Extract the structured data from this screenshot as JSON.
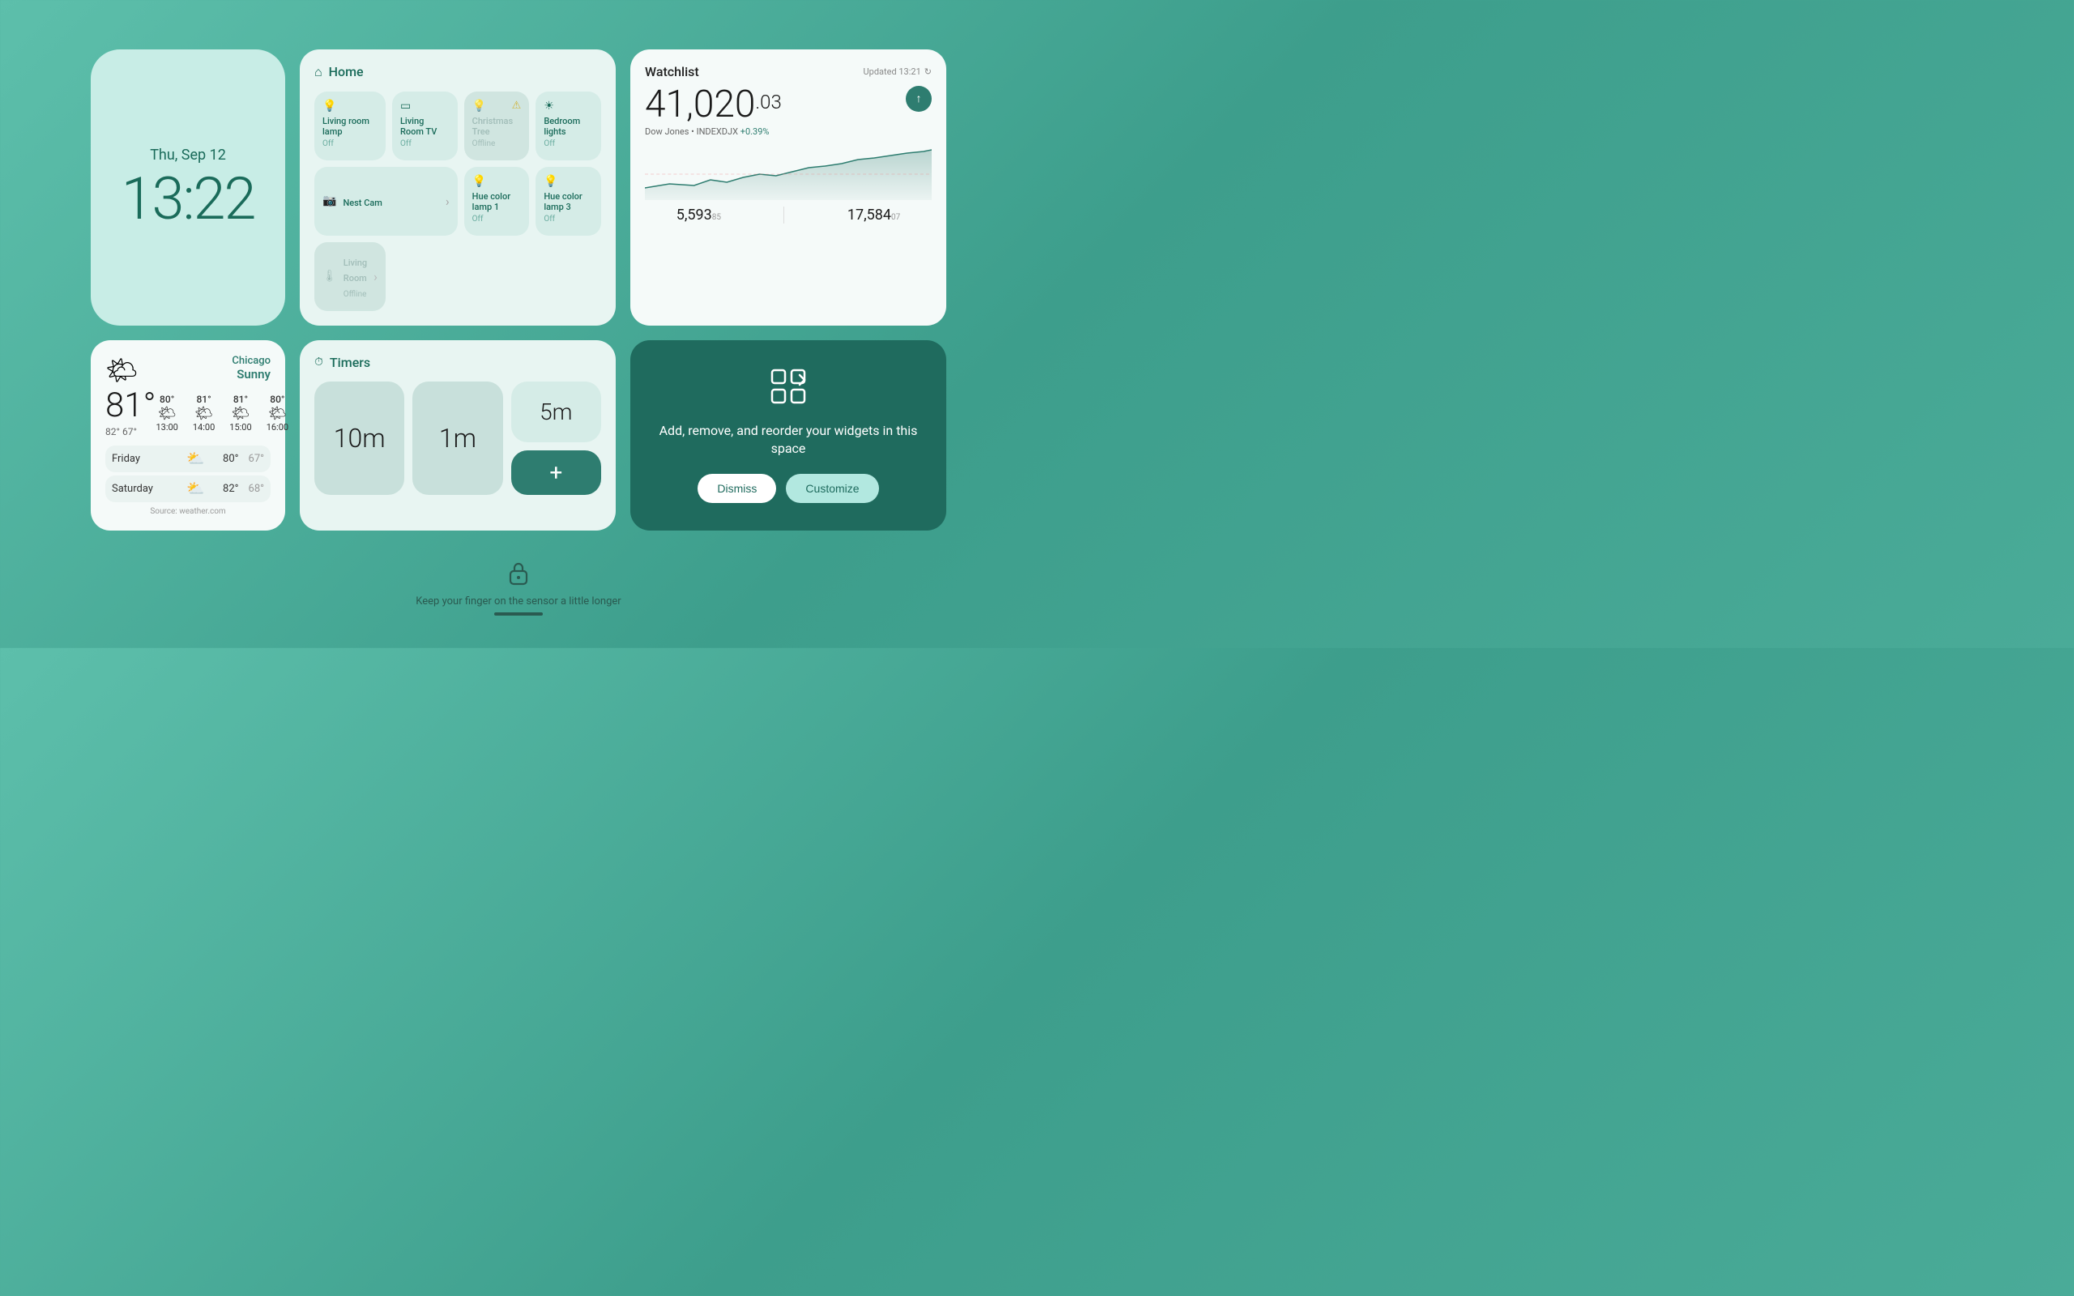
{
  "clock": {
    "date": "Thu, Sep 12",
    "time": "13:22"
  },
  "home": {
    "title": "Home",
    "devices": [
      {
        "name": "Living room lamp",
        "status": "Off",
        "offline": false,
        "icon": "💡"
      },
      {
        "name": "Living Room TV",
        "status": "Off",
        "offline": false,
        "icon": "📺"
      },
      {
        "name": "Christmas Tree",
        "status": "Offline",
        "offline": true,
        "icon": "💡",
        "warn": true
      },
      {
        "name": "Bedroom lights",
        "status": "Off",
        "offline": false,
        "icon": "🔆"
      },
      {
        "name": "Nest Cam",
        "status": "",
        "offline": false,
        "icon": "📷",
        "expand": true
      },
      {
        "name": "Hue color lamp 1",
        "status": "Off",
        "offline": false,
        "icon": "💡"
      },
      {
        "name": "Hue color lamp 3",
        "status": "Off",
        "offline": false,
        "icon": "💡"
      },
      {
        "name": "Living Room",
        "status": "Offline",
        "offline": true,
        "icon": "🌡",
        "expand": true
      }
    ]
  },
  "watchlist": {
    "title": "Watchlist",
    "updated": "Updated 13:21",
    "stock_main": "41,020",
    "stock_decimal": ".03",
    "stock_label": "Dow Jones • INDEXDJX",
    "stock_change": "+0.39%",
    "footer": [
      {
        "value": "5,593",
        "sub": "85"
      },
      {
        "value": "17,584",
        "sub": "07"
      }
    ]
  },
  "weather": {
    "location": "Chicago",
    "condition": "Sunny",
    "temp_main": "81°",
    "temp_high": "82°",
    "temp_low": "67°",
    "hourly": [
      {
        "time": "13:00",
        "temp": "80°",
        "icon": "☀"
      },
      {
        "time": "14:00",
        "temp": "81°",
        "icon": "☀"
      },
      {
        "time": "15:00",
        "temp": "81°",
        "icon": "☀"
      },
      {
        "time": "16:00",
        "temp": "80°",
        "icon": "☀"
      }
    ],
    "forecast": [
      {
        "day": "Friday",
        "icon": "⛅",
        "high": "80°",
        "low": "67°"
      },
      {
        "day": "Saturday",
        "icon": "⛅",
        "high": "82°",
        "low": "68°"
      }
    ],
    "source": "Source: weather.com"
  },
  "timers": {
    "title": "Timers",
    "items": [
      {
        "label": "10m"
      },
      {
        "label": "1m"
      },
      {
        "label": "5m"
      }
    ],
    "add_label": "+"
  },
  "promo": {
    "text": "Add, remove, and reorder your widgets in this space",
    "dismiss_label": "Dismiss",
    "customize_label": "Customize"
  },
  "bottom": {
    "hint": "Keep your finger on the sensor a little longer"
  }
}
